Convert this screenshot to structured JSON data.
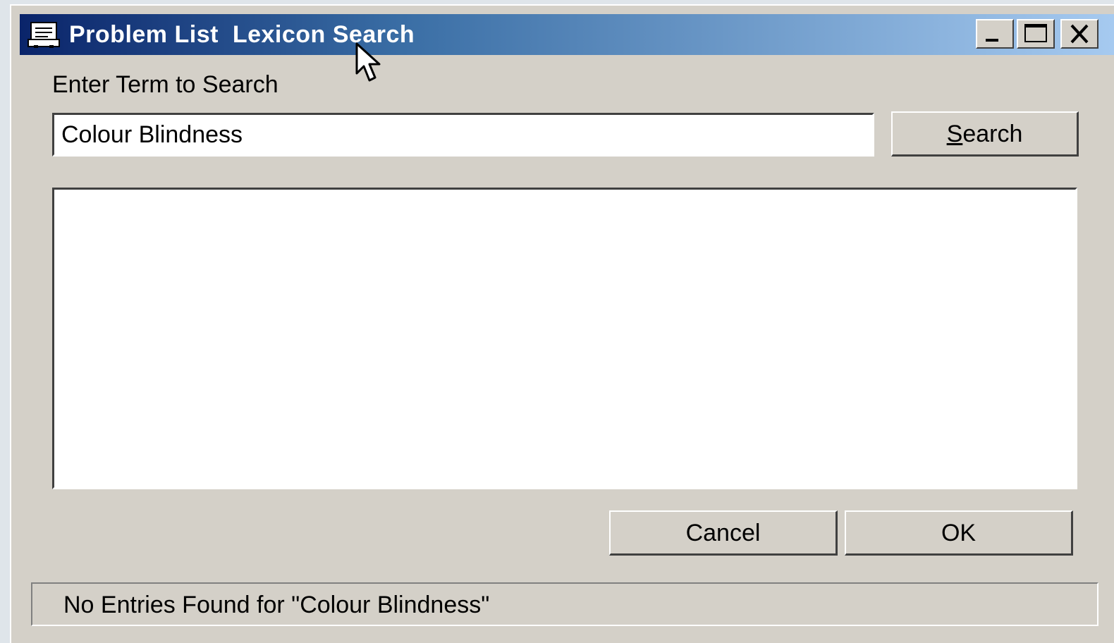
{
  "window": {
    "title": "Problem List  Lexicon Search",
    "controls": {
      "minimize": "minimize-icon",
      "maximize": "maximize-icon",
      "close": "close-icon"
    }
  },
  "search": {
    "label": "Enter Term to Search",
    "value": "Colour Blindness",
    "button_label": "Search"
  },
  "results": {
    "items": []
  },
  "actions": {
    "cancel_label": "Cancel",
    "ok_label": "OK"
  },
  "status": {
    "text": "No Entries Found for \"Colour Blindness\""
  },
  "colors": {
    "dialog_bg": "#d4d0c8",
    "title_gradient_start": "#0a246a",
    "title_gradient_end": "#a6caf0"
  }
}
